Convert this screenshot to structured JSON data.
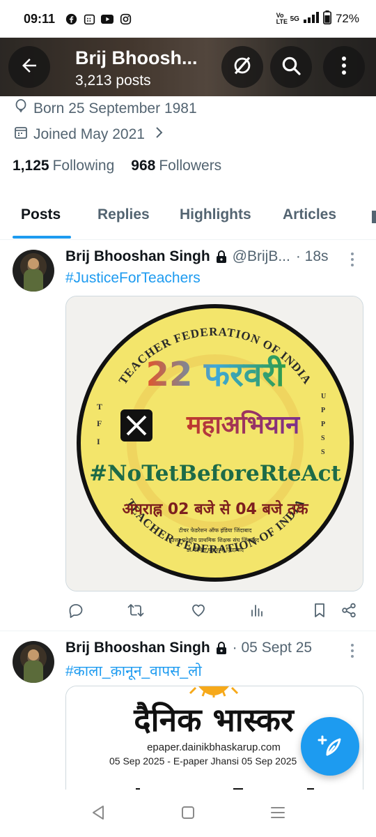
{
  "status_bar": {
    "time": "09:11",
    "battery": "72%",
    "network": "5G",
    "volte": "Vo LTE",
    "icons": [
      "facebook-icon",
      "calendar-app-icon",
      "youtube-icon",
      "instagram-icon"
    ]
  },
  "header": {
    "name": "Brij Bhoosh...",
    "posts": "3,213 posts",
    "icons": [
      "back-arrow-icon",
      "grok-icon",
      "search-icon",
      "more-vertical-icon"
    ]
  },
  "profile": {
    "born": "Born 25 September 1981",
    "joined": "Joined May 2021",
    "following_count": "1,125",
    "following_label": "Following",
    "followers_count": "968",
    "followers_label": "Followers"
  },
  "tabs": [
    {
      "label": "Posts",
      "active": true
    },
    {
      "label": "Replies"
    },
    {
      "label": "Highlights"
    },
    {
      "label": "Articles"
    }
  ],
  "tweets": [
    {
      "name": "Brij Bhooshan Singh",
      "handle": "@BrijB...",
      "time": "· 18s",
      "hashtag": "#JusticeForTeachers",
      "image": {
        "ring_top": "TEACHER FEDERATION OF INDIA",
        "ring_bottom": "TEACHER FEDERATION OF INDIA",
        "date_line": "22 फरवरी",
        "campaign": "महाअभियान",
        "hashtag": "#NoTetBeforeRteAct",
        "time_line": "अपराह्न 02 बजे से 04 बजे तक",
        "small1": "टीचर फेडरेशन ऑफ इंडिया जिंदाबाद",
        "small2": "उत्तर प्रदेशीय प्राथमिक शिक्षक संघ जिंदाबाद",
        "small3": "डॉ. दिनेश चंद्र शर्मा जिंदाबाद",
        "left_letters": [
          "T",
          "F",
          "I"
        ],
        "right_letters": [
          "U",
          "P",
          "P",
          "S",
          "S"
        ]
      }
    },
    {
      "name": "Brij Bhooshan Singh",
      "time": "· 05 Sept 25",
      "hashtag": "#काला_क़ानून_वापस_लो",
      "image": {
        "masthead": "दैनिक भास्कर",
        "site": "epaper.dainikbhaskarup.com",
        "edition": "05 Sep 2025 - E-paper Jhansi 05 Sep 2025"
      }
    }
  ],
  "colors": {
    "accent": "#1d9bf0",
    "text_primary": "#0f1419",
    "text_secondary": "#536471",
    "poster_yellow": "#f3e56b"
  }
}
